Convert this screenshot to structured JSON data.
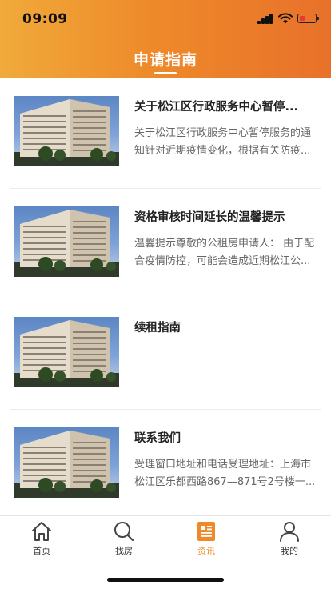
{
  "status_bar": {
    "time": "09:09"
  },
  "header": {
    "title": "申请指南"
  },
  "articles": [
    {
      "title": "关于松江区行政服务中心暂停...",
      "summary": "关于松江区行政服务中心暂停服务的通知针对近期疫情变化，根据有关防疫..."
    },
    {
      "title": "资格审核时间延长的温馨提示",
      "summary": "温馨提示尊敬的公租房申请人：  由于配合疫情防控，可能会造成近期松江公..."
    },
    {
      "title": "续租指南",
      "summary": ""
    },
    {
      "title": "联系我们",
      "summary": "受理窗口地址和电话受理地址：上海市松江区乐都西路867—871号2号楼一..."
    }
  ],
  "tabbar": {
    "items": [
      {
        "label": "首页",
        "icon": "home-icon",
        "active": false
      },
      {
        "label": "找房",
        "icon": "search-icon",
        "active": false
      },
      {
        "label": "资讯",
        "icon": "news-icon",
        "active": true
      },
      {
        "label": "我的",
        "icon": "user-icon",
        "active": false
      }
    ],
    "active_color": "#ee8a2a"
  },
  "colors": {
    "header_start": "#f0aa3a",
    "header_end": "#e8712a"
  }
}
